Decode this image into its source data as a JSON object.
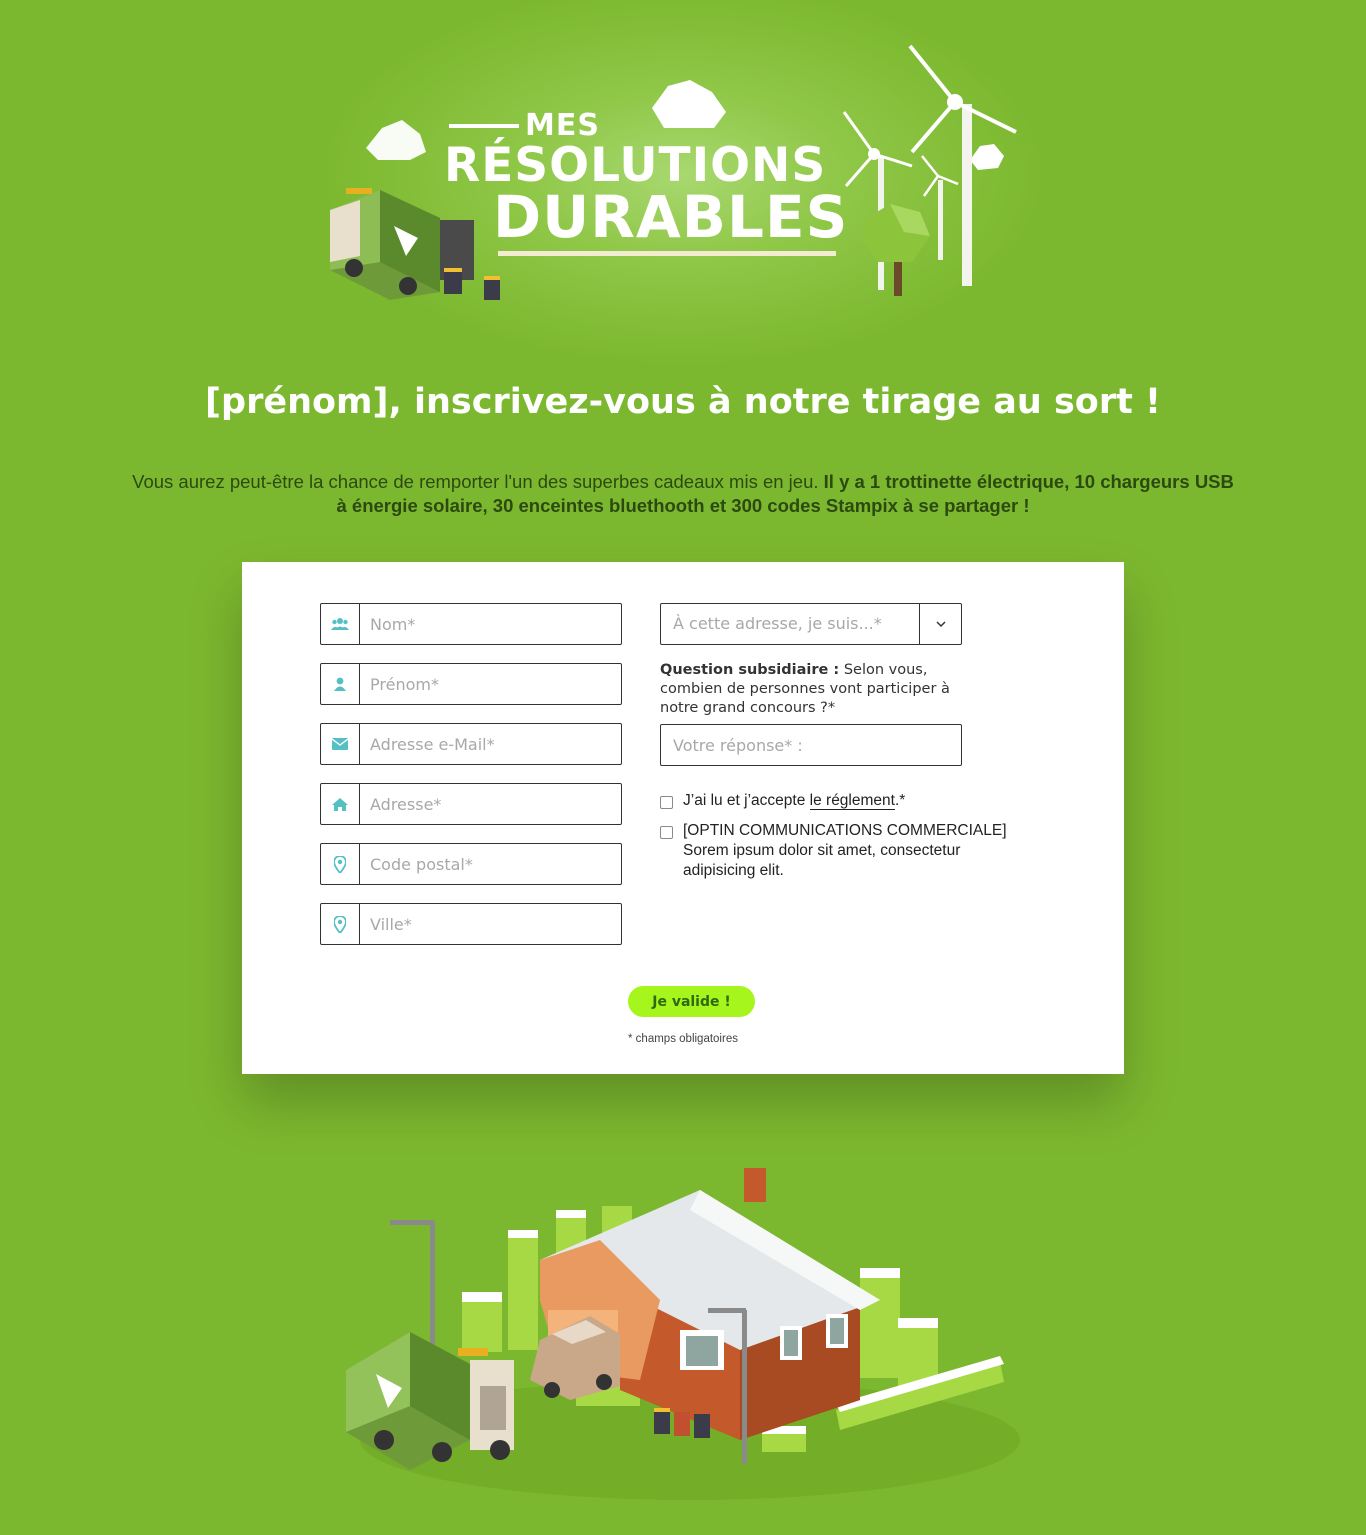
{
  "logo": {
    "line1": "MES",
    "line2": "RÉSOLUTIONS",
    "line3": "DURABLES"
  },
  "headline": "[prénom], inscrivez-vous à notre tirage au sort !",
  "intro": {
    "text": "Vous aurez peut-être la chance de remporter l'un des superbes cadeaux mis en jeu.",
    "bold": "Il y a 1 trottinette électrique, 10 chargeurs USB à énergie solaire, 30 enceintes bluethooth et 300 codes Stampix à se partager !"
  },
  "form": {
    "fields": [
      {
        "placeholder": "Nom*",
        "icon": "users-icon"
      },
      {
        "placeholder": "Prénom*",
        "icon": "user-icon"
      },
      {
        "placeholder": "Adresse e-Mail*",
        "icon": "envelope-icon"
      },
      {
        "placeholder": "Adresse*",
        "icon": "home-icon"
      },
      {
        "placeholder": "Code postal*",
        "icon": "map-marker-icon"
      },
      {
        "placeholder": "Ville*",
        "icon": "map-marker-icon"
      }
    ],
    "select": {
      "value": "À cette adresse, je suis...*"
    },
    "question": {
      "label": "Question subsidiaire :",
      "text": "Selon vous, combien de personnes vont participer à notre grand concours ?*"
    },
    "answer_placeholder": "Votre réponse* :",
    "checkboxes": [
      {
        "prefix": "J’ai lu et j’accepte ",
        "link": "le réglement",
        "suffix": ".*"
      },
      {
        "line1": "[OPTIN COMMUNICATIONS COMMERCIALE]",
        "line2": "Sorem ipsum dolor sit amet, consectetur",
        "line3": "adipisicing elit."
      }
    ],
    "submit_label": "Je valide !",
    "required_note": "* champs obligatoires"
  },
  "colors": {
    "background": "#7cb82f",
    "headline": "#ffffff",
    "icon": "#55c0c4",
    "button": "#a6f51c",
    "button_text": "#2f6a10"
  }
}
